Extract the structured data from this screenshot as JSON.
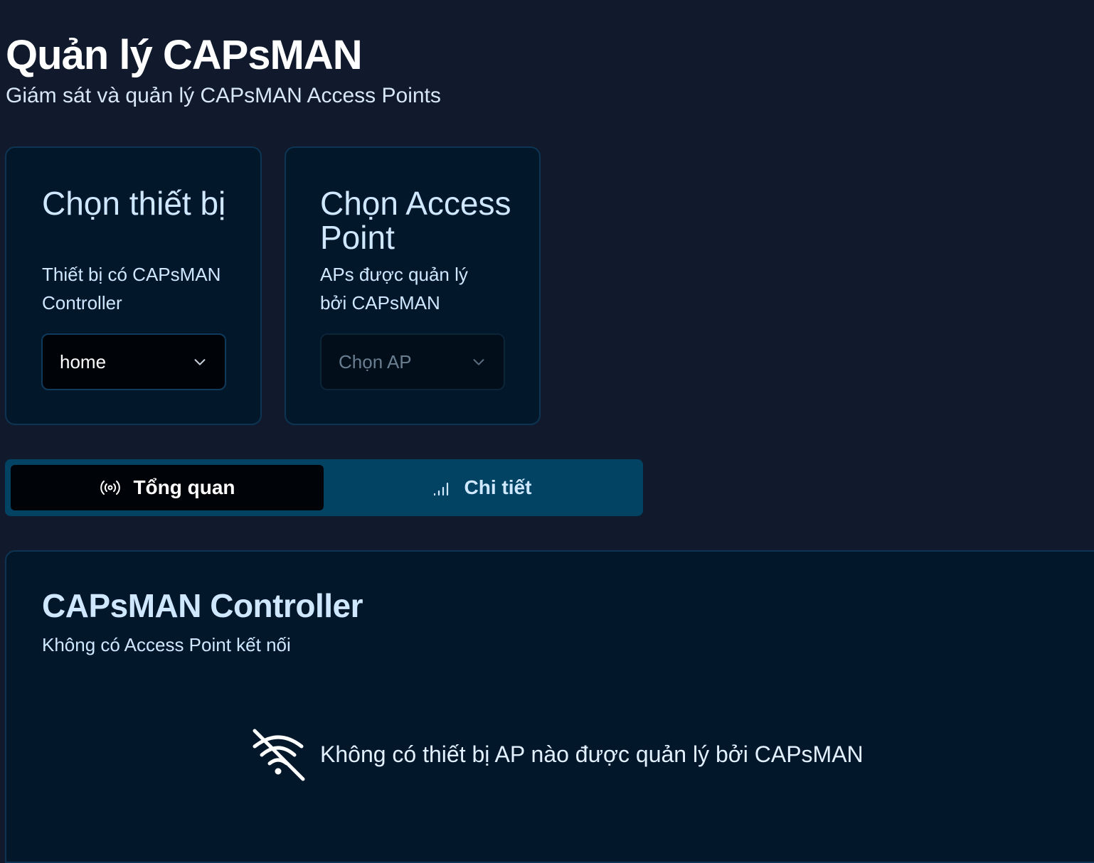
{
  "header": {
    "title": "Quản lý CAPsMAN",
    "subtitle": "Giám sát và quản lý CAPsMAN Access Points"
  },
  "device_card": {
    "title": "Chọn thiết bị",
    "description": "Thiết bị có CAPsMAN Controller",
    "selected_value": "home",
    "icon": "chevron-down-icon"
  },
  "ap_card": {
    "title": "Chọn Access Point",
    "description": "APs được quản lý bởi CAPsMAN",
    "placeholder": "Chọn AP",
    "icon": "chevron-down-icon"
  },
  "tabs": [
    {
      "label": "Tổng quan",
      "icon": "radio-broadcast-icon",
      "active": true
    },
    {
      "label": "Chi tiết",
      "icon": "signal-bars-icon",
      "active": false
    }
  ],
  "controller": {
    "title": "CAPsMAN Controller",
    "subtitle": "Không có Access Point kết nối",
    "empty_message": "Không có thiết bị AP nào được quản lý bởi CAPsMAN",
    "empty_icon": "wifi-off-icon"
  },
  "colors": {
    "background": "#111a2c",
    "card": "#02172a",
    "card_border": "#0d3553",
    "tab_bar": "#024363",
    "accent_text": "#cfe8ff"
  }
}
